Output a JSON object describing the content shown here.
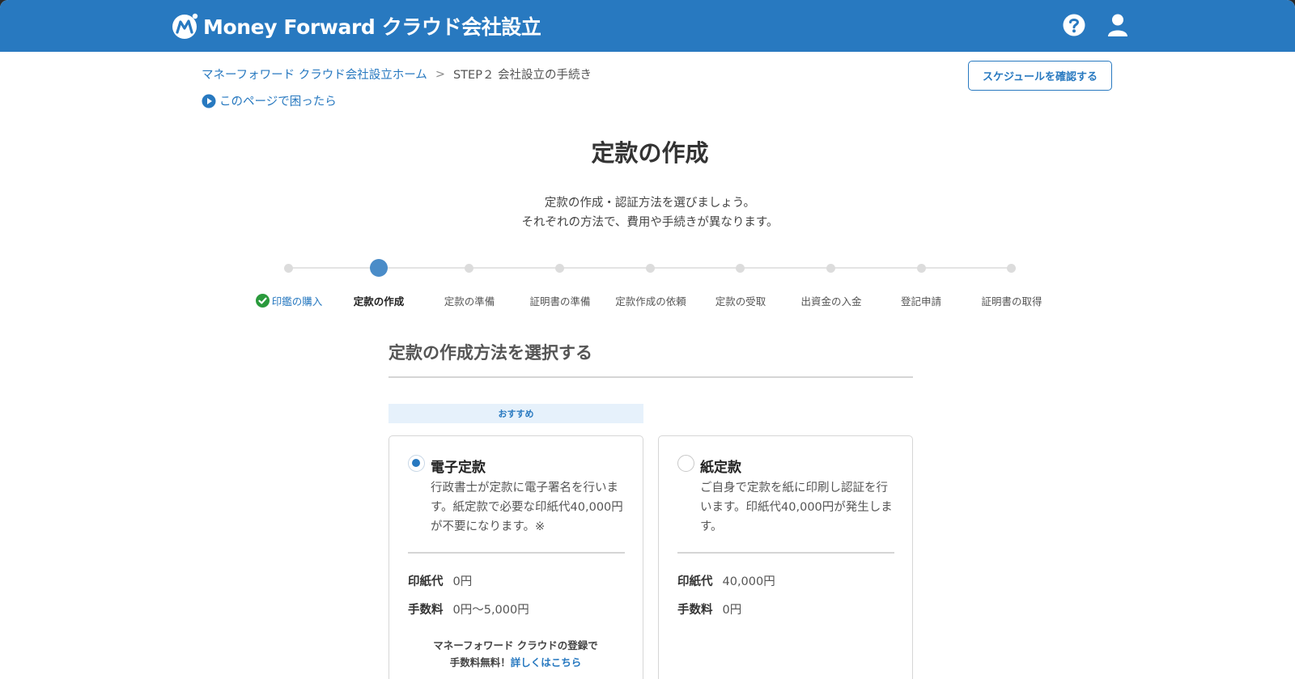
{
  "header": {
    "brand": "Money Forward",
    "product": "クラウド会社設立",
    "icons": [
      "help-icon",
      "user-icon"
    ],
    "color": "#2879c0"
  },
  "breadcrumb": {
    "home": "マネーフォワード クラウド会社設立ホーム",
    "separator": ">",
    "current": "STEP２ 会社設立の手続き"
  },
  "help_link": "このページで困ったら",
  "schedule_button": "スケジュールを確認する",
  "page_title": "定款の作成",
  "lead": {
    "line1": "定款の作成・認証方法を選びましょう。",
    "line2": "それぞれの方法で、費用や手続きが異なります。"
  },
  "steps": [
    {
      "label": "印鑑の購入",
      "state": "done"
    },
    {
      "label": "定款の作成",
      "state": "current"
    },
    {
      "label": "定款の準備",
      "state": "todo"
    },
    {
      "label": "証明書の準備",
      "state": "todo"
    },
    {
      "label": "定款作成の依頼",
      "state": "todo"
    },
    {
      "label": "定款の受取",
      "state": "todo"
    },
    {
      "label": "出資金の入金",
      "state": "todo"
    },
    {
      "label": "登記申請",
      "state": "todo"
    },
    {
      "label": "証明書の取得",
      "state": "todo"
    }
  ],
  "section_title": "定款の作成方法を選択する",
  "recommend_label": "おすすめ",
  "options": [
    {
      "title": "電子定款",
      "selected": true,
      "desc": "行政書士が定款に電子署名を行います。紙定款で必要な印紙代40,000円が不要になります。※",
      "stamp_label": "印紙代",
      "stamp_value": "0円",
      "fee_label": "手数料",
      "fee_value": "0円〜5,000円",
      "note_line1": "マネーフォワード クラウドの登録で",
      "note_line2": "手数料無料！",
      "note_link": "詳しくはこちら"
    },
    {
      "title": "紙定款",
      "selected": false,
      "desc": "ご自身で定款を紙に印刷し認証を行います。印紙代40,000円が発生します。",
      "stamp_label": "印紙代",
      "stamp_value": "40,000円",
      "fee_label": "手数料",
      "fee_value": "0円"
    }
  ]
}
